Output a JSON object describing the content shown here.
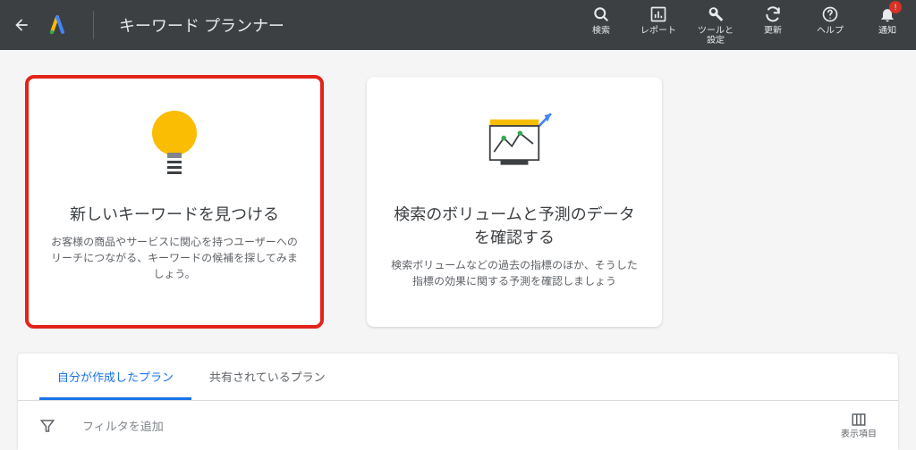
{
  "header": {
    "title": "キーワード プランナー",
    "nav": {
      "search": "検索",
      "reports": "レポート",
      "tools": "ツールと\n設定",
      "refresh": "更新",
      "help": "ヘルプ",
      "notifications": "通知",
      "notif_count": "!"
    }
  },
  "cards": {
    "discover": {
      "title": "新しいキーワードを見つける",
      "desc": "お客様の商品やサービスに関心を持つユーザーへのリーチにつながる、キーワードの候補を探してみましょう。"
    },
    "forecast": {
      "title": "検索のボリュームと予測のデータを確認する",
      "desc": "検索ボリュームなどの過去の指標のほか、そうした指標の効果に関する予測を確認しましょう"
    }
  },
  "tabs": {
    "my_plans": "自分が作成したプラン",
    "shared_plans": "共有されているプラン"
  },
  "filter": {
    "add_filter": "フィルタを追加",
    "columns": "表示項目"
  }
}
